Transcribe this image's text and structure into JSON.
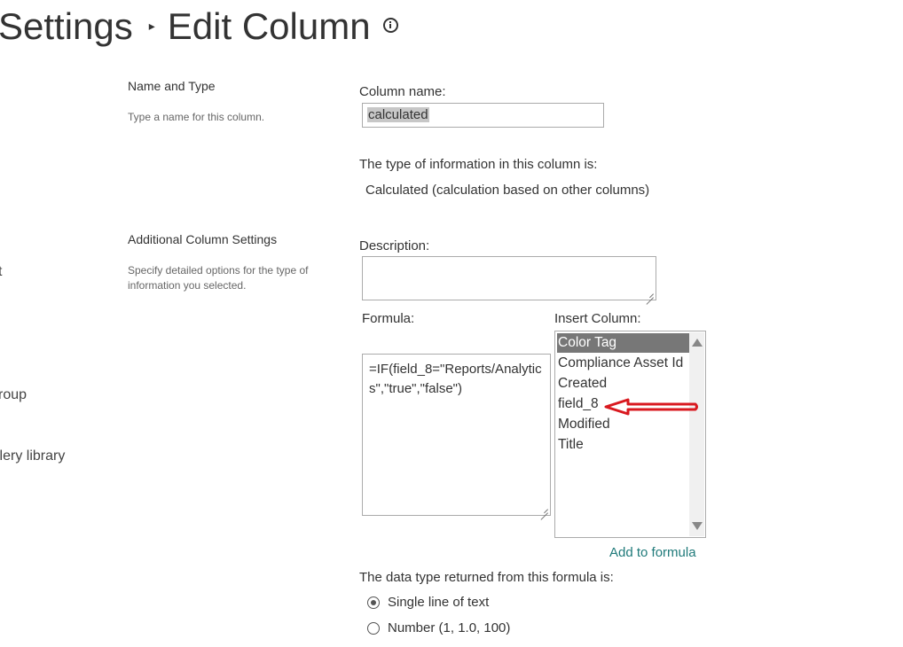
{
  "header": {
    "breadcrumb_parent": "Settings",
    "page_title": "Edit Column"
  },
  "nav": {
    "fragment_1": "t",
    "fragment_2": "roup",
    "fragment_3": "llery library"
  },
  "name_and_type": {
    "section_title": "Name and Type",
    "section_desc": "Type a name for this column.",
    "column_name_label": "Column name:",
    "column_name_value": "calculated",
    "type_label": "The type of information in this column is:",
    "type_value": "Calculated (calculation based on other columns)"
  },
  "additional": {
    "section_title": "Additional Column Settings",
    "section_desc": "Specify detailed options for the type of information you selected.",
    "description_label": "Description:",
    "description_value": "",
    "formula_label": "Formula:",
    "formula_value": "=IF(field_8=\"Reports/Analytics\",\"true\",\"false\")",
    "insert_column_label": "Insert Column:",
    "insert_columns": [
      "Color Tag",
      "Compliance Asset Id",
      "Created",
      "field_8",
      "Modified",
      "Title"
    ],
    "selected_column": "Color Tag",
    "add_to_formula": "Add to formula",
    "return_type_label": "The data type returned from this formula is:",
    "return_types": [
      {
        "label": "Single line of text",
        "checked": true
      },
      {
        "label": "Number (1, 1.0, 100)",
        "checked": false
      }
    ]
  },
  "annotation": {
    "arrow_color": "#d9191f",
    "points_to": "field_8"
  },
  "colors": {
    "link": "#1f7a7a",
    "selected_bg": "#777777"
  }
}
